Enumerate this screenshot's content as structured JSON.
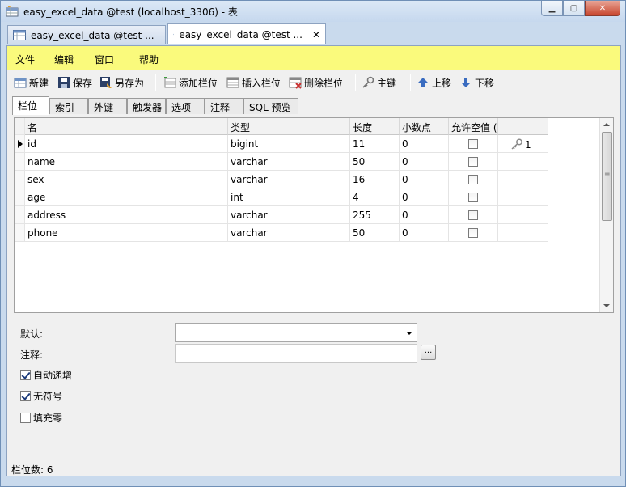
{
  "window": {
    "title": "easy_excel_data @test (localhost_3306) - 表"
  },
  "doc_tabs": [
    {
      "label": "easy_excel_data @test ..."
    },
    {
      "label": "easy_excel_data @test ...",
      "close": "✕"
    }
  ],
  "menu": {
    "items": [
      "文件",
      "编辑",
      "窗口",
      "帮助"
    ]
  },
  "toolbar": {
    "new": "新建",
    "save": "保存",
    "save_as": "另存为",
    "add_field": "添加栏位",
    "insert_field": "插入栏位",
    "delete_field": "删除栏位",
    "primary_key": "主键",
    "move_up": "上移",
    "move_down": "下移"
  },
  "sub_tabs": [
    "栏位",
    "索引",
    "外键",
    "触发器",
    "选项",
    "注释",
    "SQL 预览"
  ],
  "grid": {
    "headers": [
      "名",
      "类型",
      "长度",
      "小数点",
      "允许空值 (",
      ""
    ],
    "rows": [
      {
        "name": "id",
        "type": "bigint",
        "length": "11",
        "decimals": "0",
        "nullable": false,
        "key": "1"
      },
      {
        "name": "name",
        "type": "varchar",
        "length": "50",
        "decimals": "0",
        "nullable": false,
        "key": ""
      },
      {
        "name": "sex",
        "type": "varchar",
        "length": "16",
        "decimals": "0",
        "nullable": false,
        "key": ""
      },
      {
        "name": "age",
        "type": "int",
        "length": "4",
        "decimals": "0",
        "nullable": false,
        "key": ""
      },
      {
        "name": "address",
        "type": "varchar",
        "length": "255",
        "decimals": "0",
        "nullable": false,
        "key": ""
      },
      {
        "name": "phone",
        "type": "varchar",
        "length": "50",
        "decimals": "0",
        "nullable": false,
        "key": ""
      }
    ]
  },
  "properties": {
    "default_label": "默认:",
    "default_value": "",
    "comment_label": "注释:",
    "comment_value": "",
    "ellipsis": "...",
    "auto_increment_label": "自动递增",
    "auto_increment": true,
    "unsigned_label": "无符号",
    "unsigned": true,
    "zerofill_label": "填充零",
    "zerofill": false
  },
  "status": {
    "field_count": "栏位数: 6"
  },
  "colors": {
    "menubar": "#fafa7c",
    "title_bar": "#c6d8ee",
    "close_button": "#c8452d"
  }
}
